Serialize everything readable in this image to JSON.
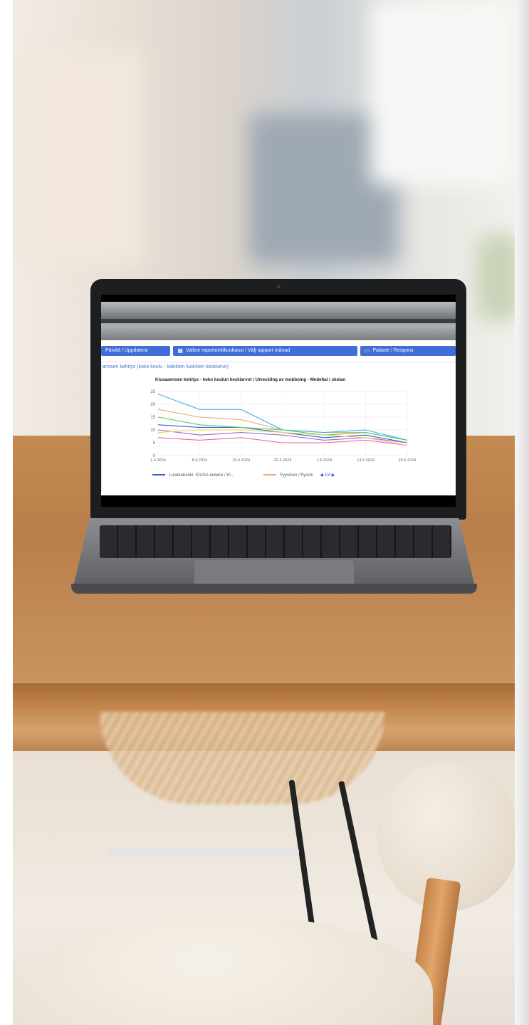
{
  "toolbar": {
    "btn1_label": "Päivitä / Uppdatera",
    "btn2_label": "Valitse raportointikuukausi / Välj rapport månad",
    "btn3_label": "Palaute / Respons"
  },
  "section": {
    "title": "amisen kehitys (koko koulu - kaikkien luokkien keskiarvo) -"
  },
  "chart_data": {
    "type": "line",
    "title": "Kiusaamisen kehitys - koko koulun keskiarvot / Utveckling av mobbning - Medeltal i skolan",
    "x": [
      "1.4.2024",
      "8.4.2024",
      "15.4.2024",
      "22.4.2024",
      "1.5.2024",
      "13.5.2024",
      "20.5.2024"
    ],
    "ylim": [
      0,
      25
    ],
    "yticks": [
      0,
      5,
      10,
      15,
      20,
      25
    ],
    "grid": true,
    "legend_position": "bottom",
    "series": [
      {
        "name": "Luokkahenki: KIUSA-indeksi / Kl…",
        "color": "#2b5fd1",
        "values": [
          12,
          11,
          11,
          9,
          7,
          8,
          5
        ]
      },
      {
        "name": "Fyysinen / Fysisk",
        "color": "#f2a37a",
        "values": [
          18,
          15,
          14,
          10,
          9,
          9,
          6
        ]
      },
      {
        "values": [
          24,
          18,
          18,
          10,
          9,
          10,
          6
        ],
        "color": "#35b6d8"
      },
      {
        "values": [
          15,
          12,
          11,
          10,
          8,
          9,
          6
        ],
        "color": "#56c76a"
      },
      {
        "values": [
          10,
          8,
          9,
          8,
          6,
          7,
          5
        ],
        "color": "#9a6ad6"
      },
      {
        "values": [
          7,
          6,
          7,
          5,
          5,
          6,
          4
        ],
        "color": "#e46aa8"
      },
      {
        "values": [
          9,
          10,
          10,
          9,
          8,
          7,
          4
        ],
        "color": "#f0d257"
      }
    ],
    "legend_pager": "1/4"
  }
}
